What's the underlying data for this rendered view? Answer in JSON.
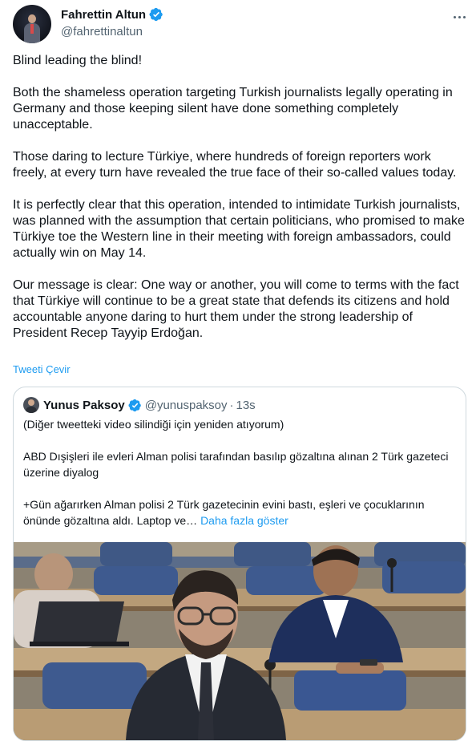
{
  "author": {
    "name": "Fahrettin Altun",
    "handle": "@fahrettinaltun"
  },
  "tweet": {
    "paragraphs": [
      "Blind leading the blind!",
      "Both the shameless operation targeting Turkish journalists legally operating in Germany and those keeping silent have done something completely unacceptable.",
      "Those daring to lecture Türkiye, where hundreds of foreign reporters work freely, at every turn have revealed the true face of their so-called values today.",
      "It is perfectly clear that this operation, intended to intimidate Turkish journalists, was planned with the assumption that certain politicians, who promised to make Türkiye toe the Western line in their meeting with foreign ambassadors, could actually win on May 14.",
      "Our message is clear: One way or another, you will come to terms with the fact that Türkiye will continue to be a great state that defends its citizens and hold accountable anyone daring to hurt them under the strong leadership of President Recep Tayyip Erdoğan."
    ],
    "translate_label": "Tweeti Çevir"
  },
  "quote": {
    "author_name": "Yunus Paksoy",
    "author_handle": "@yunuspaksoy",
    "separator": "·",
    "time": "13s",
    "paragraphs": [
      "(Diğer tweetteki video silindiği için yeniden atıyorum)",
      "ABD Dışişleri ile evleri Alman polisi tarafından basılıp gözaltına alınan 2 Türk gazeteci üzerine diyalog",
      "+Gün ağarırken Alman polisi 2 Türk gazetecinin evini bastı, eşleri ve çocuklarının önünde gözaltına aldı. Laptop ve…"
    ],
    "show_more_label": "Daha fazla göster"
  },
  "colors": {
    "text": "#0f1419",
    "secondary": "#536471",
    "link": "#1d9bf0",
    "border": "#cfd9de",
    "verified": "#1d9bf0"
  },
  "icons": [
    "verified-badge-icon",
    "more-options-icon"
  ]
}
